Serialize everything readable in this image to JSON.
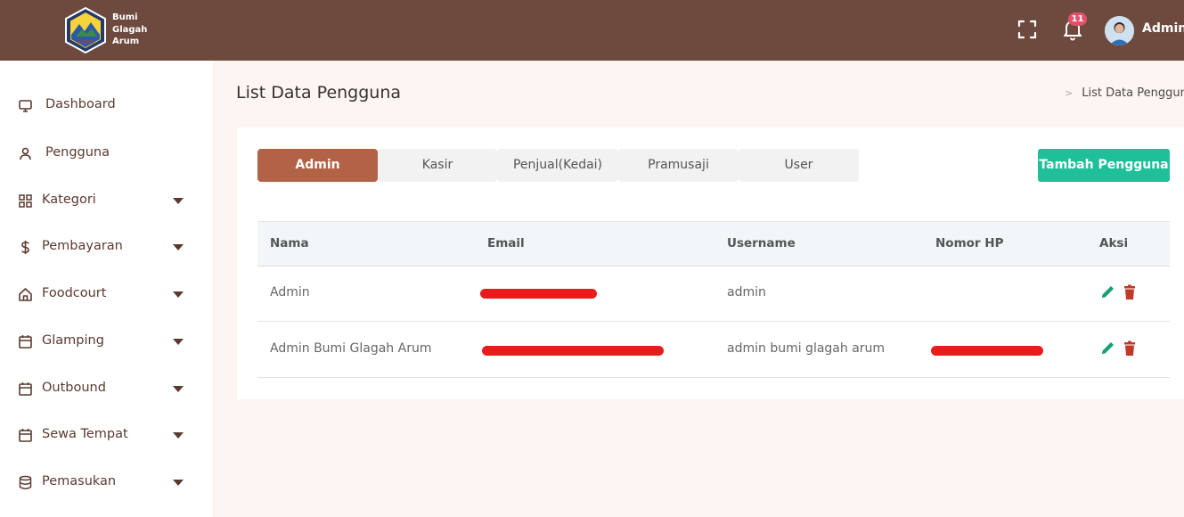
{
  "header": {
    "brand_lines": [
      "Bumi",
      "Glagah",
      "Arum"
    ],
    "notification_count": "11",
    "user_name": "Admin"
  },
  "sidebar": {
    "items": [
      {
        "label": "Dashboard",
        "icon": "monitor-icon",
        "has_submenu": false
      },
      {
        "label": "Pengguna",
        "icon": "user-icon",
        "has_submenu": false
      },
      {
        "label": "Kategori",
        "icon": "grid-icon",
        "has_submenu": true
      },
      {
        "label": "Pembayaran",
        "icon": "dollar-icon",
        "has_submenu": true
      },
      {
        "label": "Foodcourt",
        "icon": "home-icon",
        "has_submenu": true
      },
      {
        "label": "Glamping",
        "icon": "calendar-icon",
        "has_submenu": true
      },
      {
        "label": "Outbound",
        "icon": "calendar-icon",
        "has_submenu": true
      },
      {
        "label": "Sewa Tempat",
        "icon": "calendar-icon",
        "has_submenu": true
      },
      {
        "label": "Pemasukan",
        "icon": "database-icon",
        "has_submenu": true
      }
    ]
  },
  "page": {
    "title": "List Data Pengguna",
    "breadcrumb": "List Data Penggun"
  },
  "tabs": [
    {
      "label": "Admin",
      "active": true
    },
    {
      "label": "Kasir",
      "active": false
    },
    {
      "label": "Penjual(Kedai)",
      "active": false
    },
    {
      "label": "Pramusaji",
      "active": false
    },
    {
      "label": "User",
      "active": false
    }
  ],
  "add_button": "Tambah Pengguna",
  "table": {
    "headers": [
      "Nama",
      "Email",
      "Username",
      "Nomor HP",
      "Aksi"
    ],
    "rows": [
      {
        "nama": "Admin",
        "email": "[redacted]",
        "username": "admin",
        "nomor_hp": ""
      },
      {
        "nama": "Admin Bumi Glagah Arum",
        "email": "[redacted]",
        "username": "admin bumi glagah arum",
        "nomor_hp": "[redacted]"
      }
    ]
  },
  "colors": {
    "topbar": "#6e4a3e",
    "active_tab": "#b26346",
    "add_button": "#1fbf99",
    "edit_icon": "#1a9e73",
    "delete_icon": "#c0392b",
    "badge": "#e4506a"
  }
}
